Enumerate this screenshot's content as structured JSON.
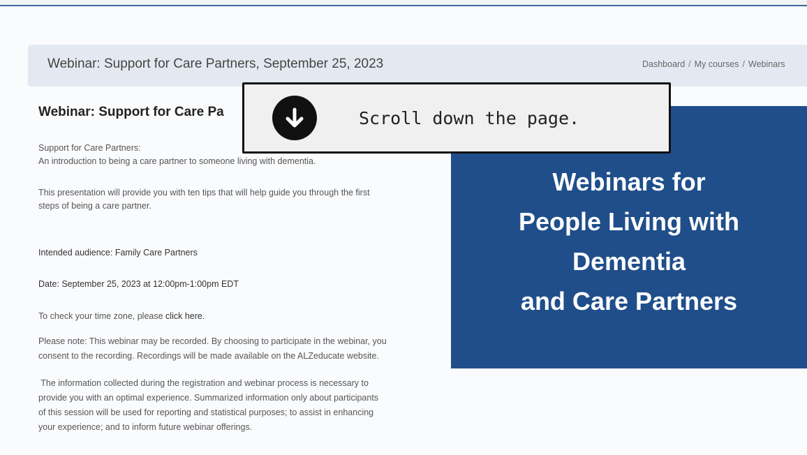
{
  "header": {
    "title": "Webinar: Support for Care Partners, September 25, 2023",
    "breadcrumb": [
      "Dashboard",
      "My courses",
      "Webinars"
    ]
  },
  "content": {
    "heading": "Webinar: Support for Care Pa",
    "intro_line1": "Support for Care Partners:",
    "intro_line2": "An introduction to being a care partner to someone living with dementia.",
    "tips_line1": "This presentation will provide you with ten tips that will help guide you through the first",
    "tips_line2": "steps of being a care partner.",
    "audience": "Intended audience: Family Care Partners",
    "date": "Date: September 25, 2023 at 12:00pm-1:00pm EDT",
    "timezone_prefix": "To check your time zone, please ",
    "timezone_link": "click here.",
    "note_line1": "Please note: This webinar may be recorded. By choosing to participate in the webinar, you",
    "note_line2": "consent to the recording. Recordings will be made available on the ALZeducate website.",
    "info_line1": " The information collected during the registration and webinar process is necessary to",
    "info_line2": "provide you with an optimal experience. Summarized information only about participants",
    "info_line3": "of this session will be used for reporting and statistical purposes; to assist in enhancing",
    "info_line4": "your experience; and to inform future webinar offerings."
  },
  "banner": {
    "lines": [
      "Webinars for",
      "People Living with",
      "Dementia",
      "and Care Partners"
    ],
    "background_color": "#1f4e8b"
  },
  "overlay": {
    "icon": "arrow-down-circle-icon",
    "instruction": "Scroll down the page."
  }
}
